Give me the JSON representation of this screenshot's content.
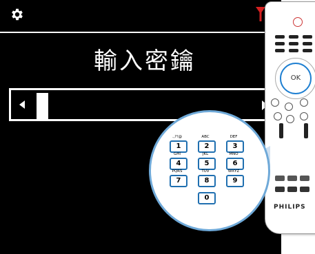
{
  "title": "輸入密鑰",
  "icons": {
    "settings": "gear-icon",
    "signal": "antenna-signal-icon"
  },
  "colors": {
    "screen": "#000000",
    "signal": "#d42020",
    "accent": "#1e7fd1"
  },
  "remote": {
    "brand": "PHILIPS",
    "ok_label": "OK"
  },
  "keypad": [
    {
      "label": ".,?!@",
      "digit": "1"
    },
    {
      "label": "ABC",
      "digit": "2"
    },
    {
      "label": "DEF",
      "digit": "3"
    },
    {
      "label": "GHI",
      "digit": "4"
    },
    {
      "label": "JKL",
      "digit": "5"
    },
    {
      "label": "MNO",
      "digit": "6"
    },
    {
      "label": "PQRS",
      "digit": "7"
    },
    {
      "label": "TUV",
      "digit": "8"
    },
    {
      "label": "WXYZ",
      "digit": "9"
    },
    {
      "label": "",
      "digit": "0"
    }
  ]
}
